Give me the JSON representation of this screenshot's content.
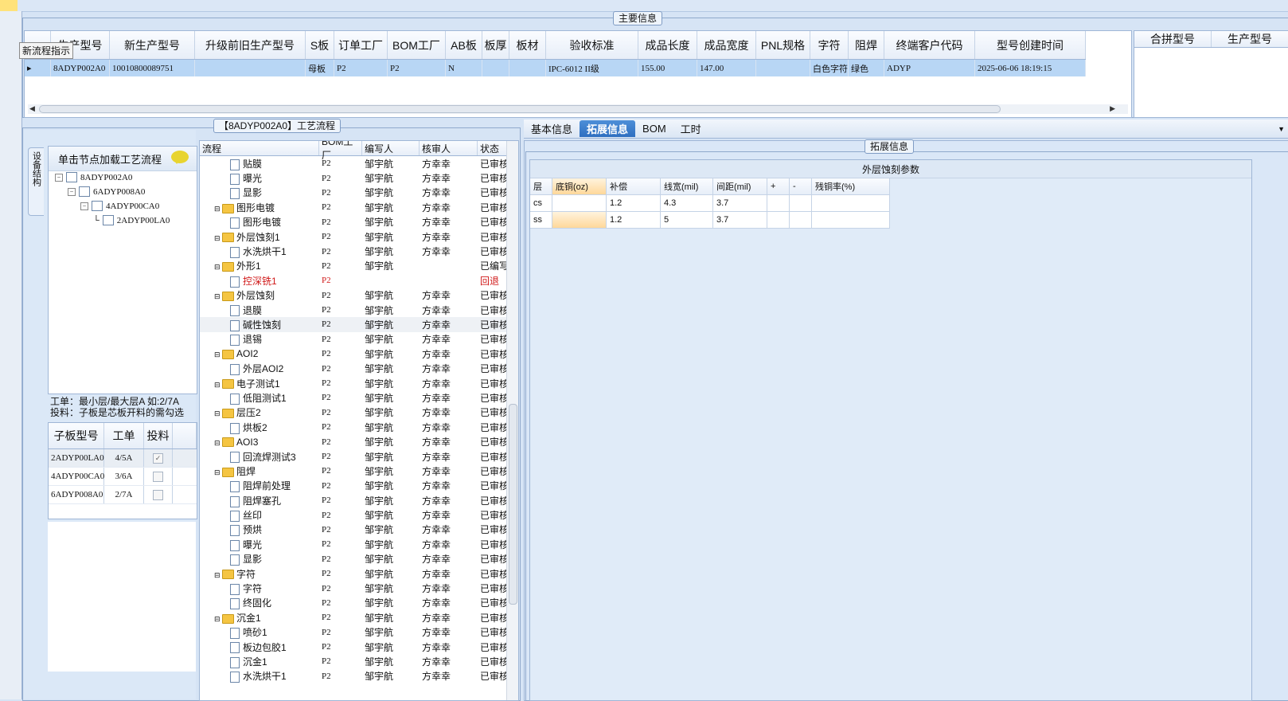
{
  "tooltip": "新流程指示",
  "main_info": {
    "legend": "主要信息",
    "columns": [
      "生产型号",
      "新生产型号",
      "升级前旧生产型号",
      "S板",
      "订单工厂",
      "BOM工厂",
      "AB板",
      "板厚",
      "板材",
      "验收标准",
      "成品长度",
      "成品宽度",
      "PNL规格",
      "字符",
      "阻焊",
      "终端客户代码",
      "型号创建时间"
    ],
    "row": {
      "marker": "▸",
      "生产型号": "8ADYP002A0",
      "新生产型号": "10010800089751",
      "升级前旧生产型号": "",
      "S板": "母板",
      "订单工厂": "P2",
      "BOM工厂": "P2",
      "AB板": "N",
      "板厚": "",
      "板材": "",
      "验收标准": "IPC-6012 II级",
      "成品长度": "155.00",
      "成品宽度": "147.00",
      "PNL规格": "",
      "字符": "白色字符",
      "阻焊": "绿色",
      "终端客户代码": "ADYP",
      "型号创建时间": "2025-06-06 18:19:15"
    },
    "right_columns": [
      "合拼型号",
      "生产型号"
    ]
  },
  "process_legend": "【8ADYP002A0】工艺流程",
  "left": {
    "vtab": "设备结构",
    "tree_hint": "单击节点加载工艺流程",
    "tree": [
      {
        "label": "8ADYP002A0",
        "level": 0,
        "expander": "⊟"
      },
      {
        "label": "6ADYP008A0",
        "level": 1,
        "expander": "⊟"
      },
      {
        "label": "4ADYP00CA0",
        "level": 2,
        "expander": "⊟"
      },
      {
        "label": "2ADYP00LA0",
        "level": 3,
        "expander": ""
      }
    ],
    "note1": "工单：最小层/最大层A 如:2/7A",
    "note2": "投料：子板是芯板开料的需勾选",
    "sub_columns": [
      "子板型号",
      "工单",
      "投料"
    ],
    "sub_rows": [
      {
        "model": "2ADYP00LA0",
        "wo": "4/5A",
        "checked": "✓"
      },
      {
        "model": "4ADYP00CA0",
        "wo": "3/6A",
        "checked": ""
      },
      {
        "model": "6ADYP008A0",
        "wo": "2/7A",
        "checked": ""
      }
    ]
  },
  "process": {
    "columns": [
      "流程",
      "BOM工厂",
      "编写人",
      "核审人",
      "状态"
    ],
    "rows": [
      {
        "name": "贴膜",
        "type": "doc",
        "f": "P2",
        "w": "邹宇航",
        "r": "方幸幸",
        "s": "已审核"
      },
      {
        "name": "曝光",
        "type": "doc",
        "f": "P2",
        "w": "邹宇航",
        "r": "方幸幸",
        "s": "已审核"
      },
      {
        "name": "显影",
        "type": "doc",
        "f": "P2",
        "w": "邹宇航",
        "r": "方幸幸",
        "s": "已审核"
      },
      {
        "name": "图形电镀",
        "type": "folder",
        "f": "P2",
        "w": "邹宇航",
        "r": "方幸幸",
        "s": "已审核"
      },
      {
        "name": "图形电镀",
        "type": "doc",
        "f": "P2",
        "w": "邹宇航",
        "r": "方幸幸",
        "s": "已审核"
      },
      {
        "name": "外层蚀刻1",
        "type": "folder",
        "f": "P2",
        "w": "邹宇航",
        "r": "方幸幸",
        "s": "已审核"
      },
      {
        "name": "水洗烘干1",
        "type": "doc",
        "f": "P2",
        "w": "邹宇航",
        "r": "方幸幸",
        "s": "已审核"
      },
      {
        "name": "外形1",
        "type": "folder",
        "f": "P2",
        "w": "邹宇航",
        "r": "",
        "s": "已编写"
      },
      {
        "name": "控深铣1",
        "type": "doc",
        "f": "P2",
        "w": "",
        "r": "",
        "s": "回退",
        "red": true
      },
      {
        "name": "外层蚀刻",
        "type": "folder",
        "f": "P2",
        "w": "邹宇航",
        "r": "方幸幸",
        "s": "已审核"
      },
      {
        "name": "退膜",
        "type": "doc",
        "f": "P2",
        "w": "邹宇航",
        "r": "方幸幸",
        "s": "已审核"
      },
      {
        "name": "碱性蚀刻",
        "type": "doc",
        "f": "P2",
        "w": "邹宇航",
        "r": "方幸幸",
        "s": "已审核",
        "sel": true
      },
      {
        "name": "退锡",
        "type": "doc",
        "f": "P2",
        "w": "邹宇航",
        "r": "方幸幸",
        "s": "已审核"
      },
      {
        "name": "AOI2",
        "type": "folder",
        "f": "P2",
        "w": "邹宇航",
        "r": "方幸幸",
        "s": "已审核"
      },
      {
        "name": "外层AOI2",
        "type": "doc",
        "f": "P2",
        "w": "邹宇航",
        "r": "方幸幸",
        "s": "已审核"
      },
      {
        "name": "电子测试1",
        "type": "folder",
        "f": "P2",
        "w": "邹宇航",
        "r": "方幸幸",
        "s": "已审核"
      },
      {
        "name": "低阻测试1",
        "type": "doc",
        "f": "P2",
        "w": "邹宇航",
        "r": "方幸幸",
        "s": "已审核"
      },
      {
        "name": "层压2",
        "type": "folder",
        "f": "P2",
        "w": "邹宇航",
        "r": "方幸幸",
        "s": "已审核"
      },
      {
        "name": "烘板2",
        "type": "doc",
        "f": "P2",
        "w": "邹宇航",
        "r": "方幸幸",
        "s": "已审核"
      },
      {
        "name": "AOI3",
        "type": "folder",
        "f": "P2",
        "w": "邹宇航",
        "r": "方幸幸",
        "s": "已审核"
      },
      {
        "name": "回流焊测试3",
        "type": "doc",
        "f": "P2",
        "w": "邹宇航",
        "r": "方幸幸",
        "s": "已审核"
      },
      {
        "name": "阻焊",
        "type": "folder",
        "f": "P2",
        "w": "邹宇航",
        "r": "方幸幸",
        "s": "已审核"
      },
      {
        "name": "阻焊前处理",
        "type": "doc",
        "f": "P2",
        "w": "邹宇航",
        "r": "方幸幸",
        "s": "已审核"
      },
      {
        "name": "阻焊塞孔",
        "type": "doc",
        "f": "P2",
        "w": "邹宇航",
        "r": "方幸幸",
        "s": "已审核"
      },
      {
        "name": "丝印",
        "type": "doc",
        "f": "P2",
        "w": "邹宇航",
        "r": "方幸幸",
        "s": "已审核"
      },
      {
        "name": "预烘",
        "type": "doc",
        "f": "P2",
        "w": "邹宇航",
        "r": "方幸幸",
        "s": "已审核"
      },
      {
        "name": "曝光",
        "type": "doc",
        "f": "P2",
        "w": "邹宇航",
        "r": "方幸幸",
        "s": "已审核"
      },
      {
        "name": "显影",
        "type": "doc",
        "f": "P2",
        "w": "邹宇航",
        "r": "方幸幸",
        "s": "已审核"
      },
      {
        "name": "字符",
        "type": "folder",
        "f": "P2",
        "w": "邹宇航",
        "r": "方幸幸",
        "s": "已审核"
      },
      {
        "name": "字符",
        "type": "doc",
        "f": "P2",
        "w": "邹宇航",
        "r": "方幸幸",
        "s": "已审核"
      },
      {
        "name": "终固化",
        "type": "doc",
        "f": "P2",
        "w": "邹宇航",
        "r": "方幸幸",
        "s": "已审核"
      },
      {
        "name": "沉金1",
        "type": "folder",
        "f": "P2",
        "w": "邹宇航",
        "r": "方幸幸",
        "s": "已审核"
      },
      {
        "name": "喷砂1",
        "type": "doc",
        "f": "P2",
        "w": "邹宇航",
        "r": "方幸幸",
        "s": "已审核"
      },
      {
        "name": "板边包胶1",
        "type": "doc",
        "f": "P2",
        "w": "邹宇航",
        "r": "方幸幸",
        "s": "已审核"
      },
      {
        "name": "沉金1",
        "type": "doc",
        "f": "P2",
        "w": "邹宇航",
        "r": "方幸幸",
        "s": "已审核"
      },
      {
        "name": "水洗烘干1",
        "type": "doc",
        "f": "P2",
        "w": "邹宇航",
        "r": "方幸幸",
        "s": "已审核"
      }
    ]
  },
  "tabs": [
    "基本信息",
    "拓展信息",
    "BOM",
    "工时"
  ],
  "active_tab": 1,
  "ext_legend": "拓展信息",
  "param": {
    "title": "外层蚀刻参数",
    "columns": [
      "层",
      "底铜(oz)",
      "补偿",
      "线宽(mil)",
      "间距(mil)",
      "+",
      "-",
      "残铜率(%)"
    ],
    "rows": [
      [
        "cs",
        "",
        "1.2",
        "4.3",
        "3.7",
        "",
        "",
        ""
      ],
      [
        "ss",
        "",
        "1.2",
        "5",
        "3.7",
        "",
        "",
        ""
      ]
    ]
  }
}
